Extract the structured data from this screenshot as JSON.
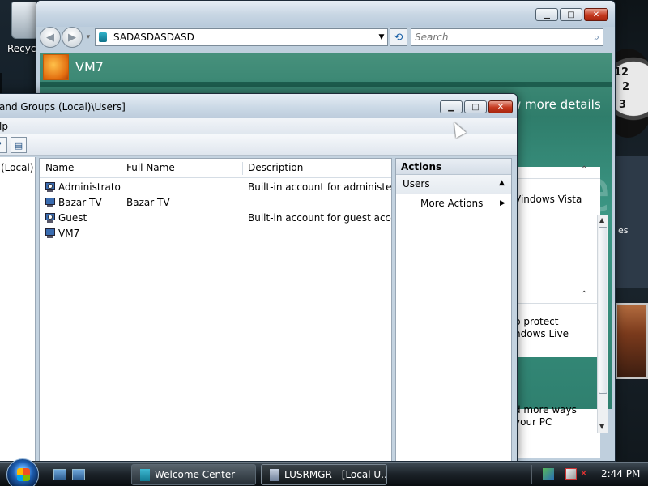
{
  "desktop": {
    "recycle_label": "Recyc",
    "clock_numbers": [
      "12",
      "2",
      "3"
    ],
    "sidebar_text": "es"
  },
  "welcome_window": {
    "address": "SADASDASDASD",
    "search_placeholder": "Search",
    "app_name": "VM7",
    "more_details": "w more details",
    "big_text": "me",
    "panel_lines_top": [
      "Vindows Vista"
    ],
    "panel_lines_bottom": [
      "p protect",
      "ndows Live",
      "d more ways",
      "your PC"
    ],
    "buttons": {
      "minimize": "▁",
      "maximize": "□",
      "close": "✕"
    }
  },
  "mmc_window": {
    "title": "and Groups (Local)\\Users]",
    "menu_partial": "lp",
    "tree_item": "(Local)",
    "columns": [
      "Name",
      "Full Name",
      "Description"
    ],
    "users": [
      {
        "name": "Administrator",
        "full_name": "",
        "description": "Built-in account for administering"
      },
      {
        "name": "Bazar TV",
        "full_name": "Bazar TV",
        "description": ""
      },
      {
        "name": "Guest",
        "full_name": "",
        "description": "Built-in account for guest access t"
      },
      {
        "name": "VM7",
        "full_name": "",
        "description": ""
      }
    ],
    "actions": {
      "header": "Actions",
      "section": "Users",
      "item": "More Actions"
    },
    "buttons": {
      "minimize": "▁",
      "maximize": "□",
      "close": "✕"
    }
  },
  "taskbar": {
    "tasks": [
      "Welcome Center",
      "LUSRMGR - [Local U..."
    ],
    "time": "2:44 PM"
  }
}
